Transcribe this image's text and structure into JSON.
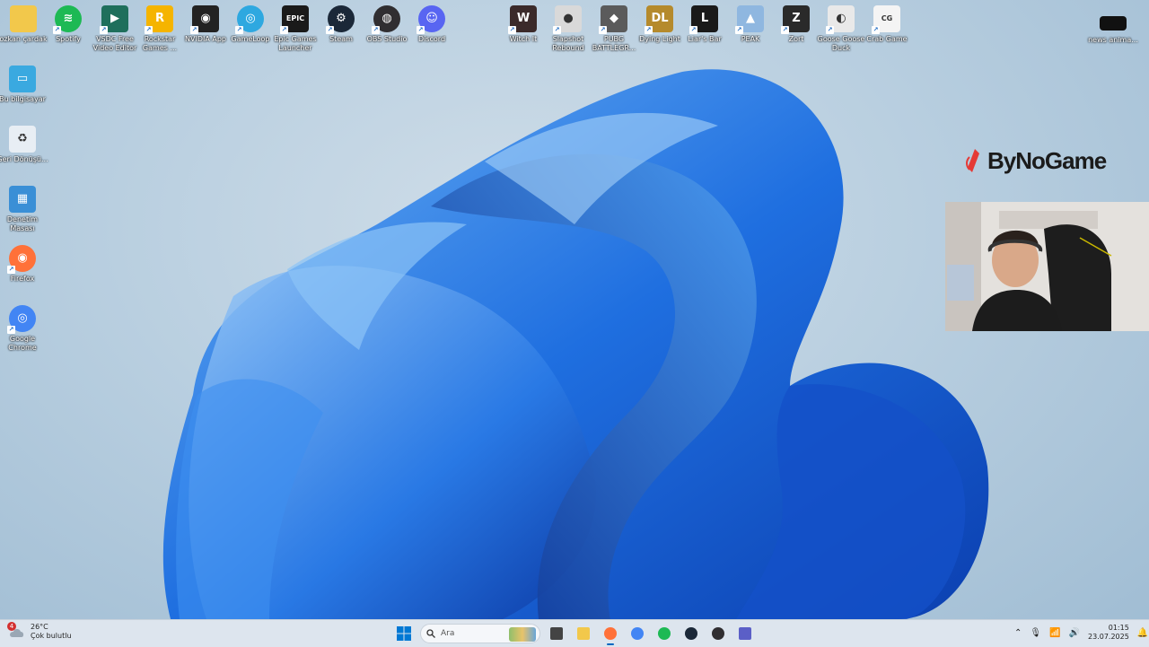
{
  "desktop": {
    "top_icons": [
      {
        "label": "ozkan çardak",
        "icon": "folder-icon",
        "color": "#f2c84b"
      },
      {
        "label": "Spotify",
        "icon": "spotify-icon",
        "color": "#1db954"
      },
      {
        "label": "VSDC Free Video Editor",
        "icon": "vsdc-icon",
        "color": "#1f6f5c"
      },
      {
        "label": "Rockstar Games ...",
        "icon": "rockstar-icon",
        "color": "#f5b400"
      },
      {
        "label": "NVIDIA App",
        "icon": "nvidia-icon",
        "color": "#222222"
      },
      {
        "label": "GameLoop",
        "icon": "gameloop-icon",
        "color": "#2ea8e0"
      },
      {
        "label": "Epic Games Launcher",
        "icon": "epic-games-icon",
        "color": "#1a1a1a"
      },
      {
        "label": "Steam",
        "icon": "steam-icon",
        "color": "#1b2838"
      },
      {
        "label": "OBS Studio",
        "icon": "obs-icon",
        "color": "#302e31"
      },
      {
        "label": "Discord",
        "icon": "discord-icon",
        "color": "#5865f2"
      },
      {
        "label": "Witch It",
        "icon": "witch-it-icon",
        "color": "#3b2a2a"
      },
      {
        "label": "Slapshot Rebound",
        "icon": "slapshot-icon",
        "color": "#d9d9d9"
      },
      {
        "label": "PUBG BATTLEGR...",
        "icon": "pubg-icon",
        "color": "#5b5b5b"
      },
      {
        "label": "Dying Light",
        "icon": "dying-light-icon",
        "color": "#b58a2c"
      },
      {
        "label": "Liar's Bar",
        "icon": "liars-bar-icon",
        "color": "#1a1a1a"
      },
      {
        "label": "PEAK",
        "icon": "peak-icon",
        "color": "#8fb7e0"
      },
      {
        "label": "Zort",
        "icon": "zort-icon",
        "color": "#2a2a2a"
      },
      {
        "label": "Goose Goose Duck",
        "icon": "goose-icon",
        "color": "#e9e9e9"
      },
      {
        "label": "Crab Game",
        "icon": "crab-game-icon",
        "color": "#f4f4f4"
      }
    ],
    "right_icon": {
      "label": "news anima...",
      "icon": "video-file-icon",
      "color": "#111111"
    },
    "left_icons": [
      {
        "label": "Bu bilgisayar",
        "icon": "this-pc-icon",
        "color": "#3aa9e0"
      },
      {
        "label": "Geri Dönüşü...",
        "icon": "recycle-bin-icon",
        "color": "#e8eef4"
      },
      {
        "label": "Denetim Masası",
        "icon": "control-panel-icon",
        "color": "#3a8fd6"
      },
      {
        "label": "Firefox",
        "icon": "firefox-icon",
        "color": "#ff7139"
      },
      {
        "label": "Google Chrome",
        "icon": "chrome-icon",
        "color": "#4285f4"
      }
    ]
  },
  "overlay": {
    "brand": "ByNoGame"
  },
  "taskbar": {
    "weather": {
      "temp": "26°C",
      "desc": "Çok bulutlu",
      "badge": "4"
    },
    "search_placeholder": "Ara",
    "apps": [
      {
        "name": "task-view-icon",
        "active": false
      },
      {
        "name": "file-explorer-icon",
        "active": false
      },
      {
        "name": "firefox-icon",
        "active": true
      },
      {
        "name": "chrome-icon",
        "active": false
      },
      {
        "name": "spotify-icon",
        "active": false
      },
      {
        "name": "steam-icon",
        "active": false
      },
      {
        "name": "obs-icon",
        "active": false
      },
      {
        "name": "teams-icon",
        "active": false
      }
    ],
    "clock": {
      "time": "01:15",
      "date": "23.07.2025"
    }
  }
}
